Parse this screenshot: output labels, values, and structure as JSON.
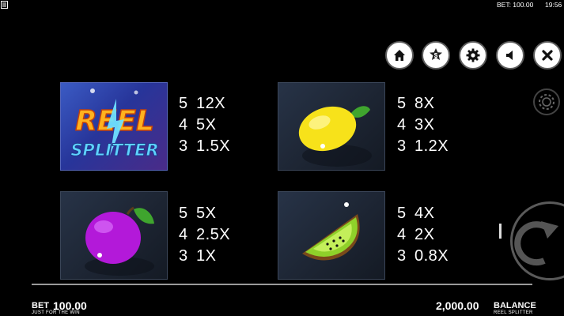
{
  "status_bar": {
    "bet_text": "BET: 100.00",
    "clock": "19:56"
  },
  "toolbar": {
    "buttons": [
      "home",
      "coin-star",
      "settings",
      "sound",
      "close"
    ],
    "coin_symbol": "$"
  },
  "paytable": [
    {
      "symbol": "reel-splitter-logo",
      "logo_lines": [
        "REEL",
        "SPLITTER"
      ],
      "pays": [
        {
          "count": "5",
          "multiplier": "12X"
        },
        {
          "count": "4",
          "multiplier": "5X"
        },
        {
          "count": "3",
          "multiplier": "1.5X"
        }
      ]
    },
    {
      "symbol": "lemon",
      "pays": [
        {
          "count": "5",
          "multiplier": "8X"
        },
        {
          "count": "4",
          "multiplier": "3X"
        },
        {
          "count": "3",
          "multiplier": "1.2X"
        }
      ]
    },
    {
      "symbol": "plum",
      "pays": [
        {
          "count": "5",
          "multiplier": "5X"
        },
        {
          "count": "4",
          "multiplier": "2.5X"
        },
        {
          "count": "3",
          "multiplier": "1X"
        }
      ]
    },
    {
      "symbol": "kiwi",
      "pays": [
        {
          "count": "5",
          "multiplier": "4X"
        },
        {
          "count": "4",
          "multiplier": "2X"
        },
        {
          "count": "3",
          "multiplier": "0.8X"
        }
      ]
    }
  ],
  "footer": {
    "bet_label": "BET",
    "bet_value": "100.00",
    "bet_sub": "JUST FOR THE WIN",
    "balance_value": "2,000.00",
    "balance_label": "BALANCE",
    "balance_sub": "REEL SPLITTER"
  },
  "colors": {
    "background": "#000000",
    "tile": "#1f2836",
    "button_fill": "#ffffff",
    "icon": "#111111"
  }
}
